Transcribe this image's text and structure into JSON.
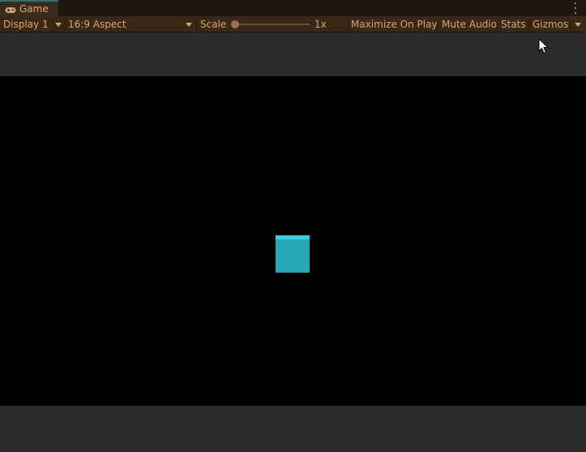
{
  "window": {
    "tab_label": "Game",
    "tab_icon": "gamepad-icon",
    "menu_icon": "kebab-menu-icon"
  },
  "toolbar": {
    "display": "Display 1",
    "aspect": "16:9 Aspect",
    "scale_label": "Scale",
    "scale_value": "1x",
    "scale_level": 0,
    "maximize_on_play": "Maximize On Play",
    "mute_audio": "Mute Audio",
    "stats": "Stats",
    "gizmos": "Gizmos"
  },
  "colors": {
    "accent_text": "#d9a66a",
    "toolbar_bg": "#3a2816",
    "viewport_bg": "#000000",
    "cube_top": "#2fd0df",
    "cube_front": "#27a6b6"
  },
  "scene": {
    "object": "cube"
  }
}
